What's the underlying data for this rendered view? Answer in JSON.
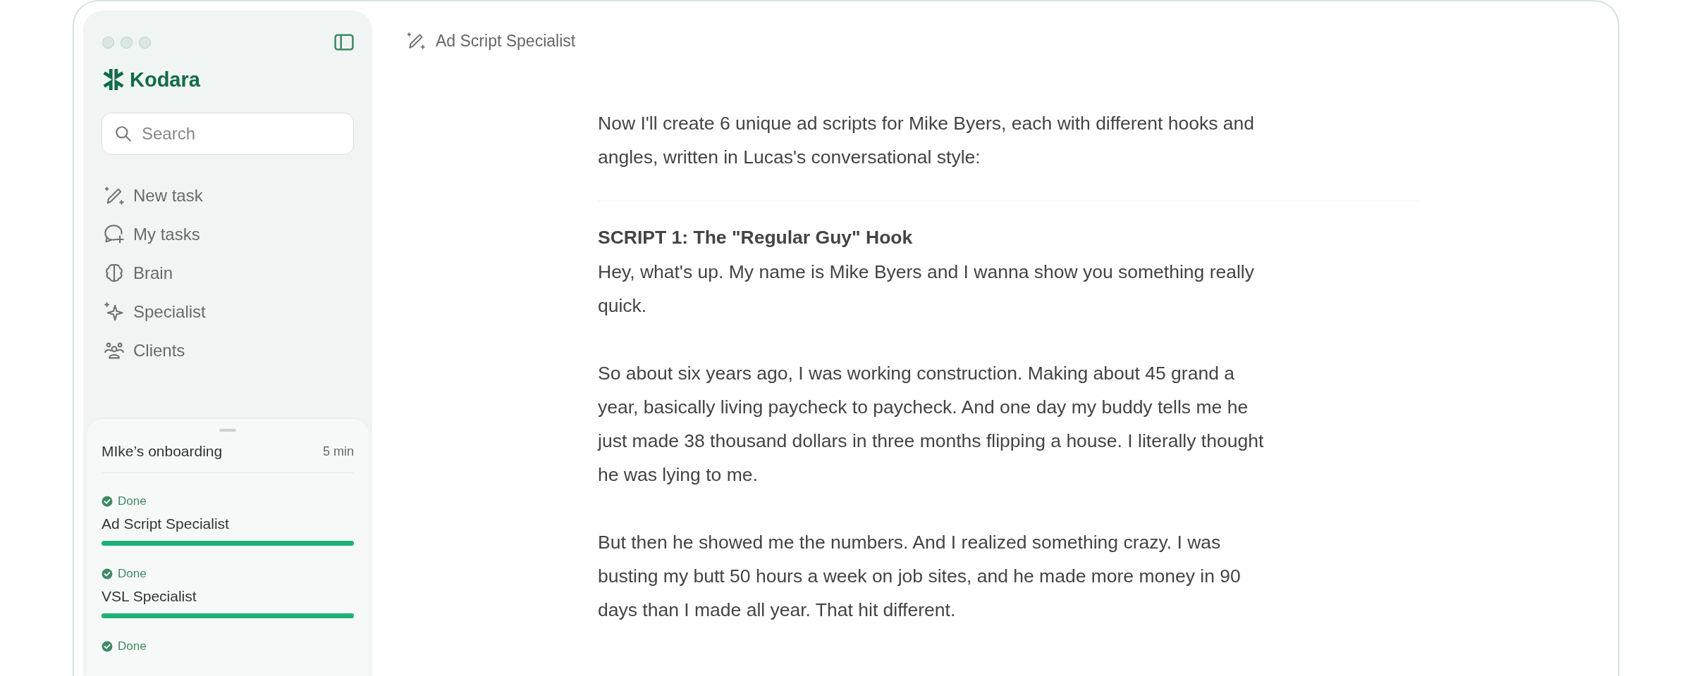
{
  "sidebar": {
    "brand": "Kodara",
    "search": {
      "placeholder": "Search"
    },
    "nav": [
      {
        "label": "New task"
      },
      {
        "label": "My tasks"
      },
      {
        "label": "Brain"
      },
      {
        "label": "Specialist"
      },
      {
        "label": "Clients"
      }
    ],
    "progress": {
      "title": "MIke’s onboarding",
      "duration": "5 min",
      "tasks": [
        {
          "status": "Done",
          "done": true,
          "name": "Ad Script Specialist",
          "level": 1
        },
        {
          "status": "Done",
          "done": true,
          "name": "VSL Specialist",
          "level": 1
        },
        {
          "status": "Done",
          "done": true
        }
      ]
    }
  },
  "header": {
    "title": "Ad Script Specialist"
  },
  "content": {
    "intro": "Now I'll create 6 unique ad scripts for Mike Byers, each with different hooks and angles, written in Lucas's conversational style:",
    "heading": "SCRIPT 1: The \"Regular Guy\" Hook",
    "paragraphs": [
      "Hey, what's up. My name is Mike Byers and I wanna show you something really quick.",
      "So about six years ago, I was working construction. Making about 45 grand a year, basically living paycheck to paycheck. And one day my buddy tells me he just made 38 thousand dollars in three months flipping a house. I literally thought he was lying to me.",
      "But then he showed me the numbers. And I realized something crazy. I was busting my butt 50 hours a week on job sites, and he made more money in 90 days than I made all year. That hit different."
    ]
  }
}
